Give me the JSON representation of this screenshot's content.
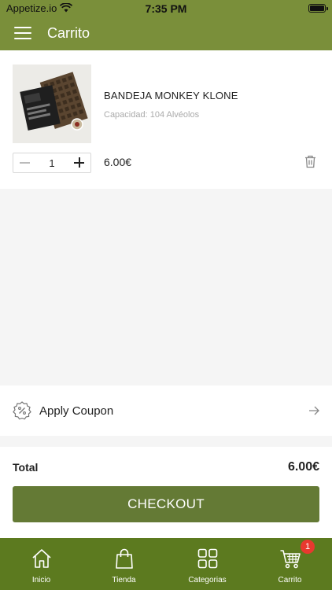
{
  "status_bar": {
    "carrier": "Appetize.io",
    "time": "7:35 PM"
  },
  "header": {
    "title": "Carrito"
  },
  "cart": {
    "items": [
      {
        "name": "BANDEJA MONKEY KLONE",
        "capacity": "Capacidad: 104 Alvéolos",
        "quantity": "1",
        "price": "6.00€"
      }
    ]
  },
  "coupon": {
    "label": "Apply Coupon"
  },
  "summary": {
    "total_label": "Total",
    "total_value": "6.00€"
  },
  "checkout": {
    "label": "CHECKOUT"
  },
  "tabs": [
    {
      "label": "Inicio",
      "icon": "home-icon"
    },
    {
      "label": "Tienda",
      "icon": "shopping-bag-icon"
    },
    {
      "label": "Categorias",
      "icon": "grid-icon"
    },
    {
      "label": "Carrito",
      "icon": "cart-icon",
      "badge": "1"
    }
  ],
  "colors": {
    "brand": "#7a8f3a",
    "button": "#647a35",
    "tabbar": "#5c7a1f",
    "badge": "#e8392f"
  }
}
